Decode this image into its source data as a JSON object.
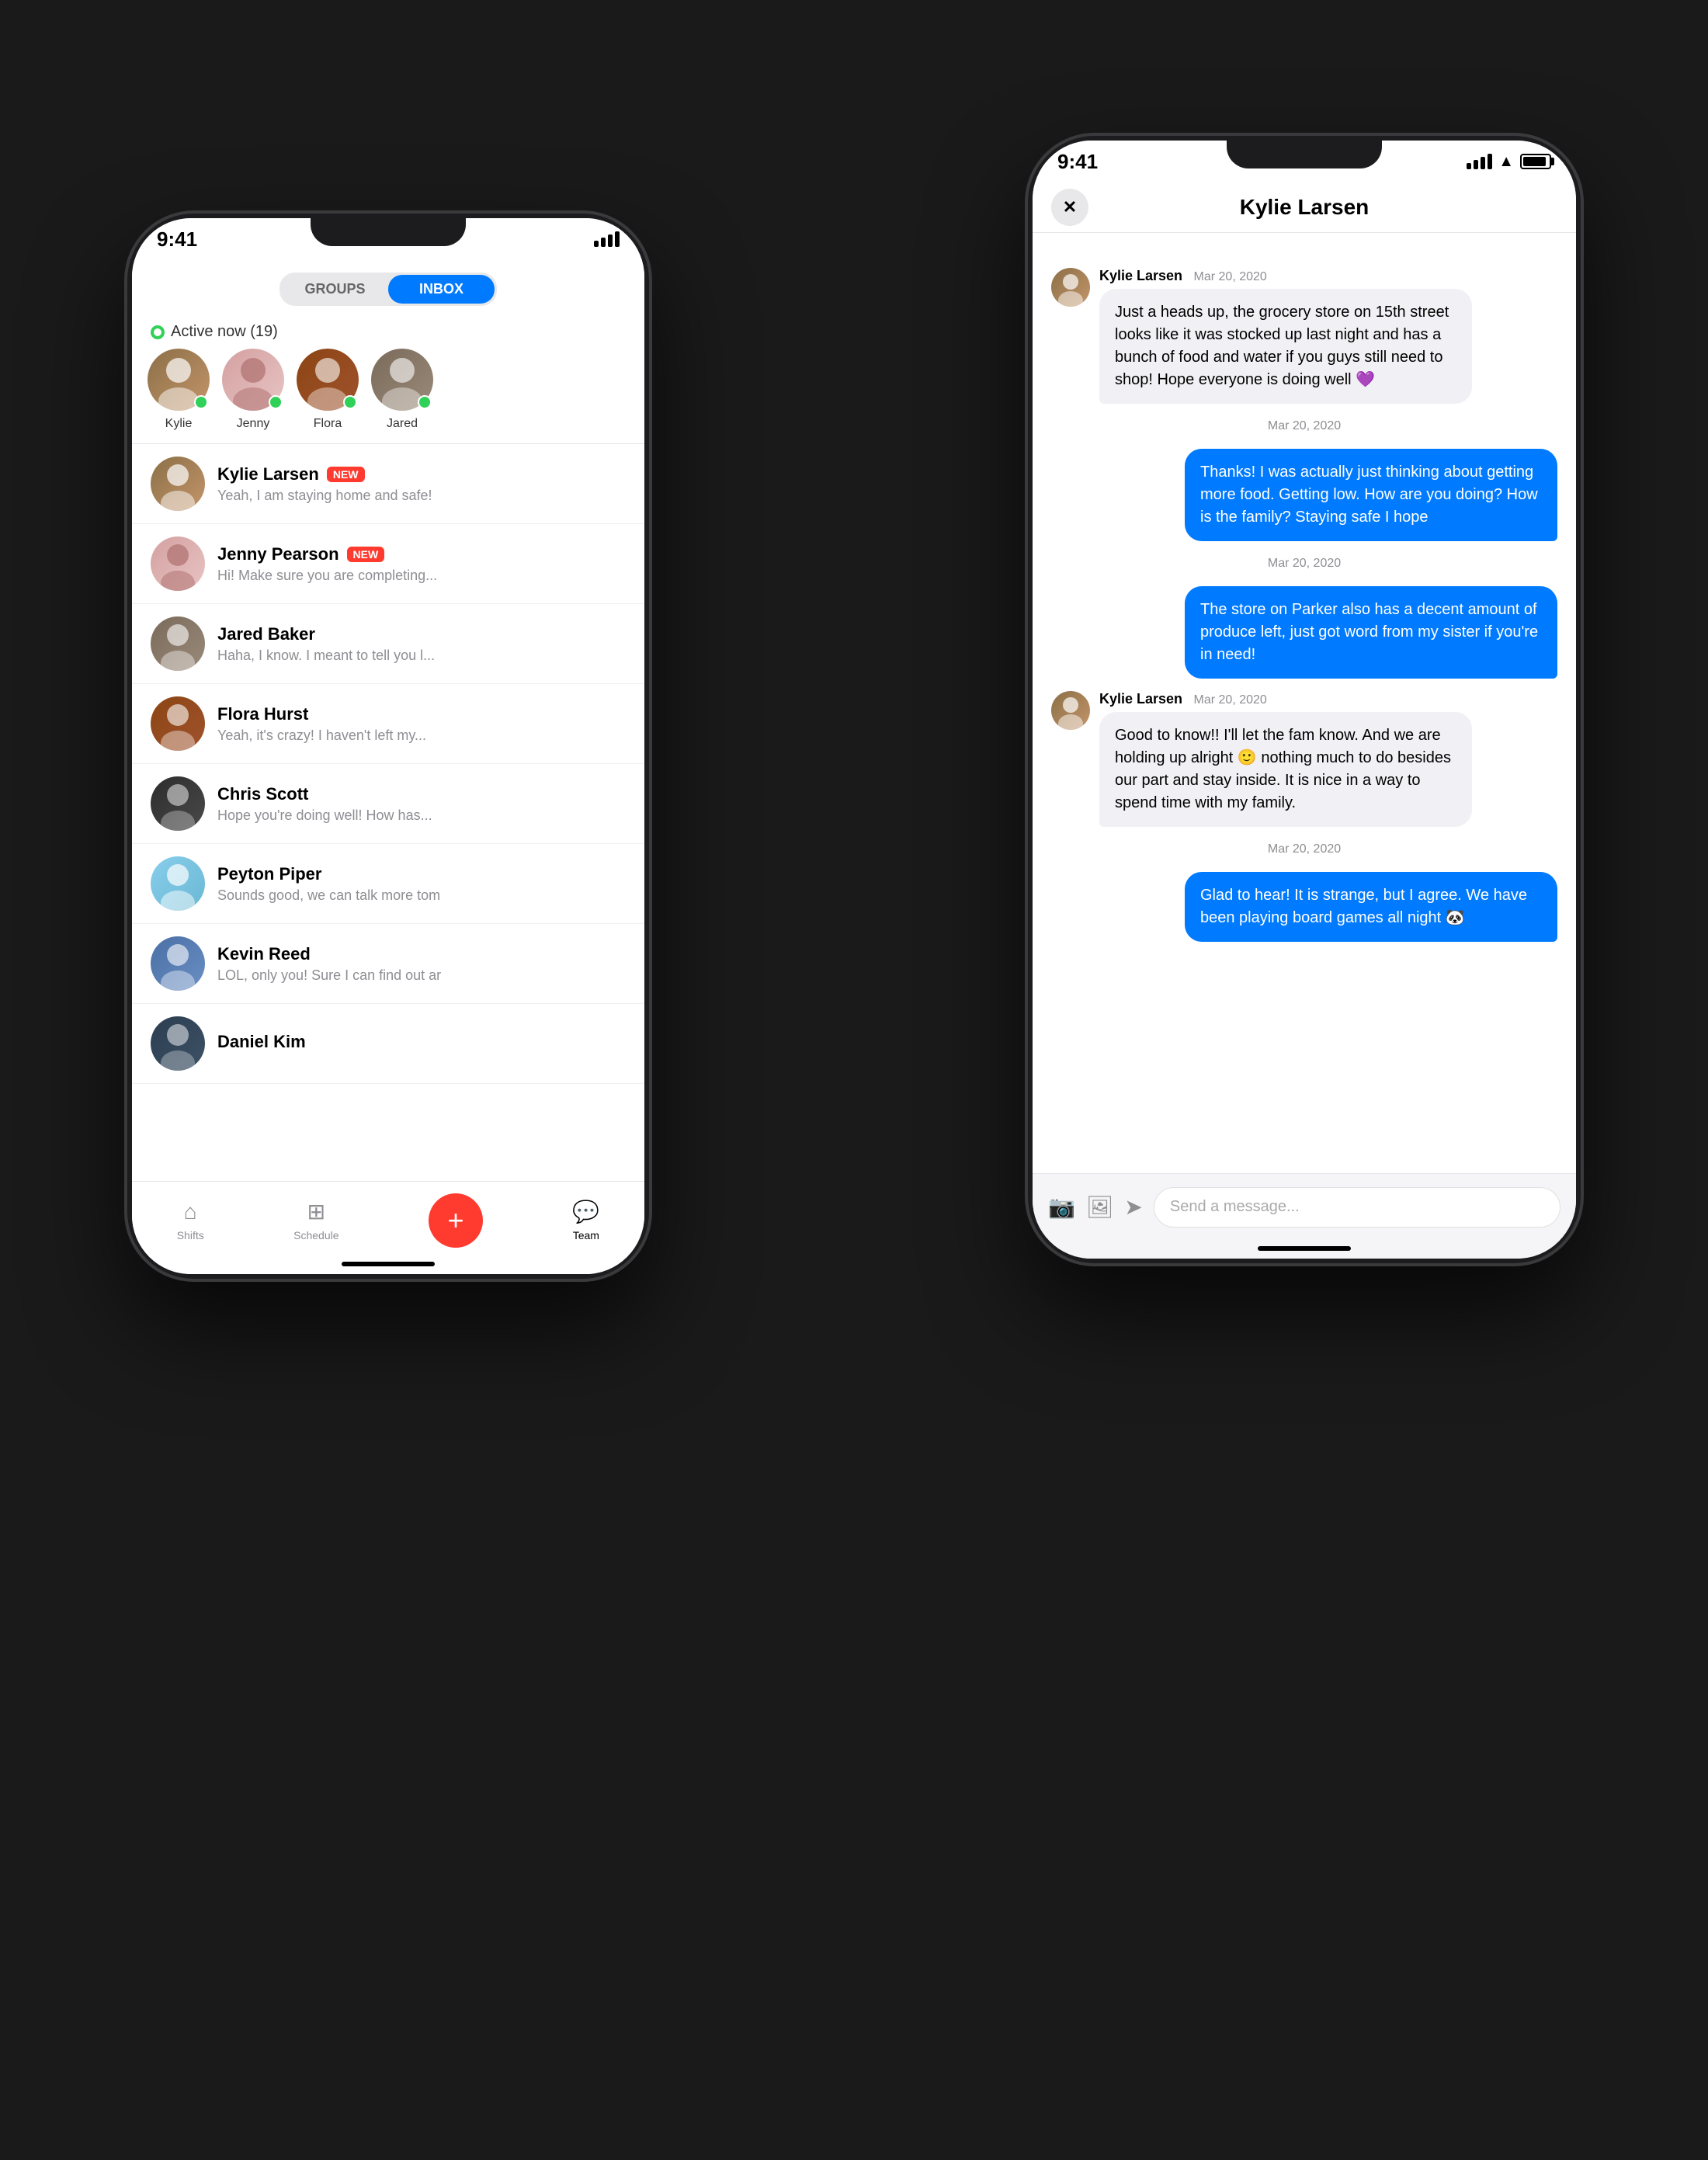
{
  "scene": {
    "background": "#1a1a1a"
  },
  "left_phone": {
    "status_bar": {
      "time": "9:41"
    },
    "tabs": {
      "groups_label": "GROUPS",
      "inbox_label": "INBOX",
      "active_tab": "inbox"
    },
    "active_section": {
      "label": "Active now (19)"
    },
    "avatars": [
      {
        "name": "Kylie",
        "color": "av-kylie"
      },
      {
        "name": "Jenny",
        "color": "av-jenny"
      },
      {
        "name": "Flora",
        "color": "av-flora"
      },
      {
        "name": "Jared",
        "color": "av-jared"
      }
    ],
    "messages": [
      {
        "name": "Kylie Larsen",
        "badge": "NEW",
        "preview": "Yeah, I am staying home and safe!",
        "color": "av-kylie"
      },
      {
        "name": "Jenny Pearson",
        "badge": "NEW",
        "preview": "Hi! Make sure you are completing...",
        "color": "av-jenny"
      },
      {
        "name": "Jared Baker",
        "badge": null,
        "preview": "Haha, I know. I meant to tell you I...",
        "color": "av-jared"
      },
      {
        "name": "Flora Hurst",
        "badge": null,
        "preview": "Yeah, it's crazy! I haven't left my...",
        "color": "av-flora"
      },
      {
        "name": "Chris Scott",
        "badge": null,
        "preview": "Hope you're doing well! How has...",
        "color": "av-chris"
      },
      {
        "name": "Peyton Piper",
        "badge": null,
        "preview": "Sounds good, we can talk more tom",
        "color": "av-peyton"
      },
      {
        "name": "Kevin Reed",
        "badge": null,
        "preview": "LOL, only you! Sure I can find out ar",
        "color": "av-kevin"
      },
      {
        "name": "Daniel Kim",
        "badge": null,
        "preview": "",
        "color": "av-daniel"
      }
    ],
    "bottom_nav": [
      {
        "label": "Shifts",
        "icon": "⌂",
        "active": false
      },
      {
        "label": "Schedule",
        "icon": "⊞",
        "active": false
      },
      {
        "label": "",
        "icon": "+",
        "active": false,
        "special": true
      },
      {
        "label": "Team",
        "icon": "💬",
        "active": true
      }
    ]
  },
  "right_phone": {
    "status_bar": {
      "time": "9:41"
    },
    "header": {
      "close_icon": "✕",
      "title": "Kylie Larsen"
    },
    "messages": [
      {
        "type": "incoming",
        "sender": "Kylie Larsen",
        "time": "Mar 20, 2020",
        "text": "Just a heads up, the grocery store on 15th street looks like it was stocked up last night and has a bunch of food and water if you guys still need to shop! Hope everyone is doing well 💜"
      },
      {
        "type": "timestamp",
        "time": "Mar 20, 2020"
      },
      {
        "type": "outgoing",
        "text": "Thanks! I was actually just thinking about getting more food. Getting low. How are you doing? How is the family? Staying safe I hope"
      },
      {
        "type": "timestamp",
        "time": "Mar 20, 2020"
      },
      {
        "type": "outgoing",
        "text": "The store on Parker also has a decent amount of produce left, just got word from my sister if you're in need!"
      },
      {
        "type": "incoming",
        "sender": "Kylie Larsen",
        "time": "Mar 20, 2020",
        "text": "Good to know!! I'll let the fam know. And we are holding up alright 🙂 nothing much to do besides our part and stay inside. It is nice in a way to spend time with my family."
      },
      {
        "type": "timestamp",
        "time": "Mar 20, 2020"
      },
      {
        "type": "outgoing",
        "text": "Glad to hear! It is strange, but I agree. We have been playing board games all night 🐼"
      }
    ],
    "input_bar": {
      "placeholder": "Send a message...",
      "camera_icon": "📷",
      "image_icon": "🖼",
      "send_icon": "➤"
    }
  }
}
